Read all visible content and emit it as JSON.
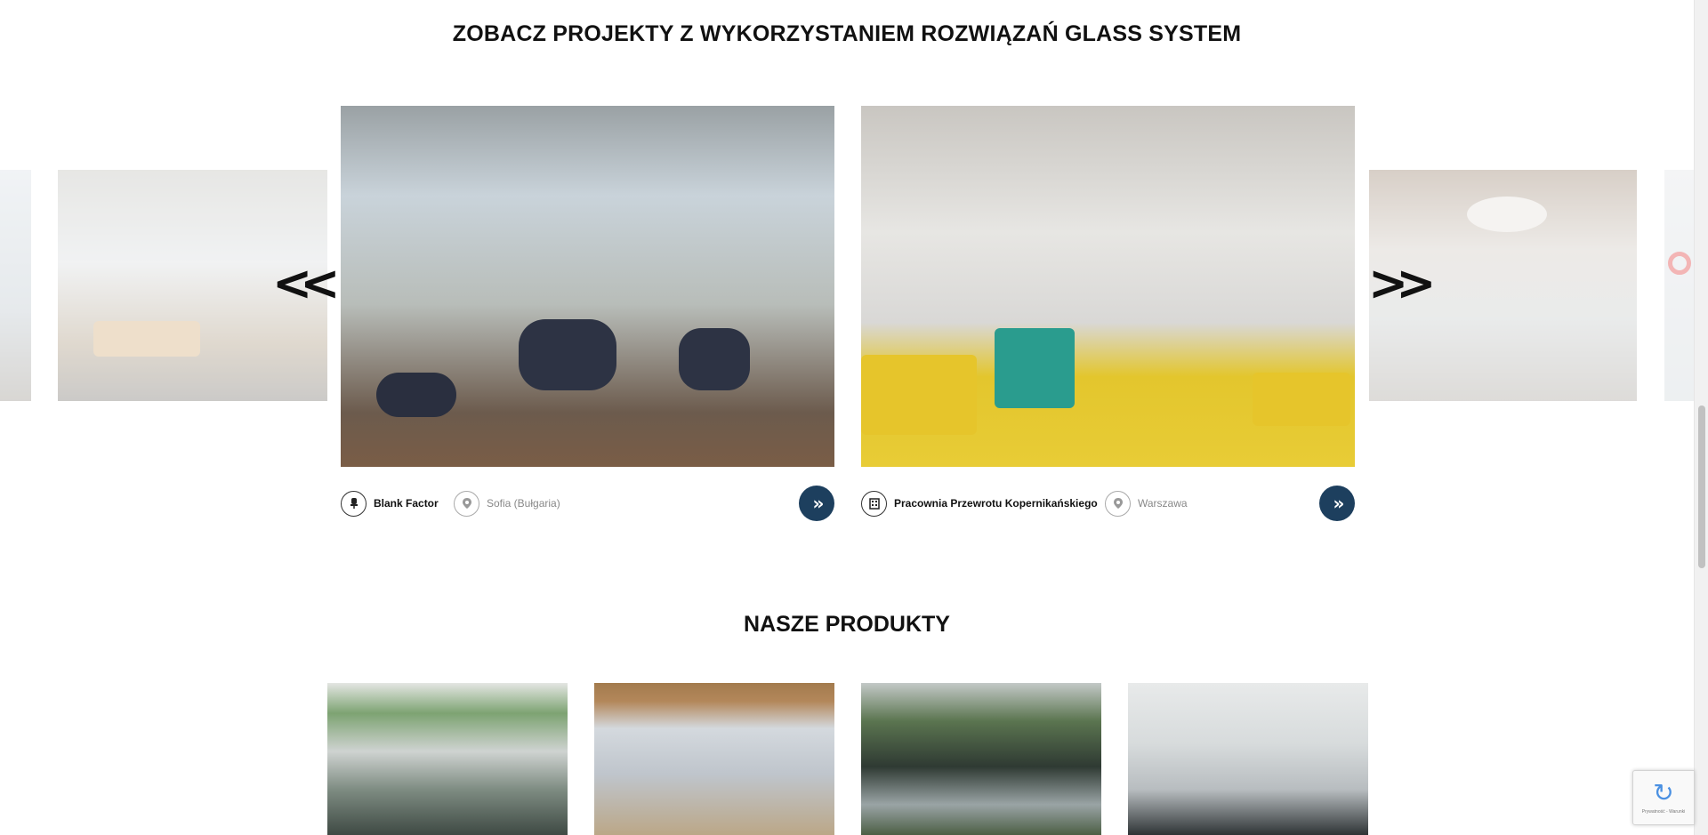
{
  "sections": {
    "projects_title": "ZOBACZ PROJEKTY Z WYKORZYSTANIEM ROZWIĄZAŃ GLASS SYSTEM",
    "products_title": "NASZE PRODUKTY"
  },
  "carousel": {
    "prev_arrow": "<<",
    "next_arrow": ">>",
    "slides": [
      {
        "name": "Blank Factor",
        "location": "Sofia (Bułgaria)",
        "more": "»"
      },
      {
        "name": "Pracownia Przewrotu Kopernikańskiego",
        "location": "Warszawa",
        "more": "»"
      }
    ]
  },
  "icons": {
    "chair_icon": "chair-icon",
    "building_icon": "building-icon",
    "pin_icon": "location-pin-icon"
  },
  "recaptcha": {
    "terms": "Prywatność - Warunki"
  },
  "colors": {
    "more_button": "#1d3f5e",
    "title_text": "#111111",
    "location_text": "#888888"
  }
}
